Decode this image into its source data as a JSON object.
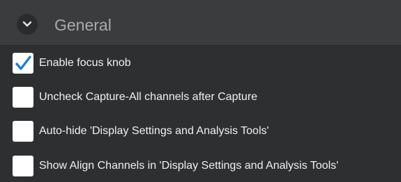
{
  "section": {
    "title": "General",
    "toggle_icon": "chevron-down-icon",
    "expanded": true
  },
  "options": [
    {
      "label": "Enable focus knob",
      "checked": true
    },
    {
      "label": "Uncheck Capture-All channels after Capture",
      "checked": false
    },
    {
      "label": "Auto-hide 'Display Settings and Analysis Tools'",
      "checked": false
    },
    {
      "label": "Show Align Channels in 'Display Settings and Analysis Tools'",
      "checked": false
    }
  ],
  "colors": {
    "background": "#2e2f31",
    "header_background": "#3b3c3e",
    "checkmark": "#1e7fd8",
    "checkbox_fill": "#ffffff",
    "label_text": "#f1f1f1",
    "title_text": "#a9aaac"
  }
}
